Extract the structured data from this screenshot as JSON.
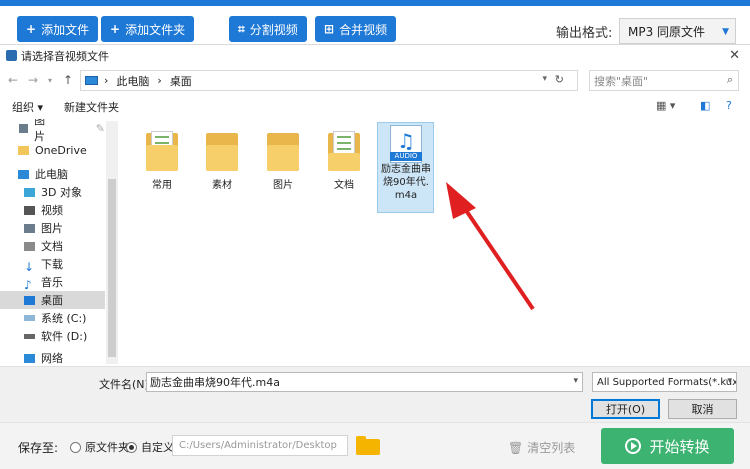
{
  "toolbar": {
    "add_file": "添加文件",
    "add_folder": "添加文件夹",
    "split_video": "分割视频",
    "merge_video": "合并视频",
    "format_label": "输出格式:",
    "format_value": "MP3  同原文件"
  },
  "dialog": {
    "title": "请选择音视频文件",
    "breadcrumb": [
      "此电脑",
      "桌面"
    ],
    "search_placeholder": "搜索\"桌面\"",
    "organize": "组织 ▾",
    "new_folder": "新建文件夹",
    "nav_items": [
      {
        "label": "图片",
        "icon": "picture-icon"
      },
      {
        "label": "OneDrive",
        "icon": "folder-icon"
      },
      {
        "label": "此电脑",
        "icon": "pc-icon"
      },
      {
        "label": "3D 对象",
        "icon": "cube-icon"
      },
      {
        "label": "视频",
        "icon": "video-icon"
      },
      {
        "label": "图片",
        "icon": "picture-icon"
      },
      {
        "label": "文档",
        "icon": "document-icon"
      },
      {
        "label": "下载",
        "icon": "download-icon"
      },
      {
        "label": "音乐",
        "icon": "music-icon"
      },
      {
        "label": "桌面",
        "icon": "desktop-icon"
      },
      {
        "label": "系统 (C:)",
        "icon": "drive-icon"
      },
      {
        "label": "软件 (D:)",
        "icon": "drive-icon"
      },
      {
        "label": "网络",
        "icon": "network-icon"
      }
    ],
    "files": [
      {
        "name": "常用"
      },
      {
        "name": "素材"
      },
      {
        "name": "图片"
      },
      {
        "name": "文档"
      }
    ],
    "selected_file": {
      "line1": "励志金曲串",
      "line2": "烧90年代.",
      "line3": "m4a",
      "tag": "AUDIO"
    },
    "filename_label": "文件名(N):",
    "filename_value": "励志金曲串烧90年代.m4a",
    "filter_value": "All Supported Formats(*.kux",
    "open_button": "打开(O)",
    "cancel_button": "取消"
  },
  "footer": {
    "save_label": "保存至:",
    "radio_original": "原文件夹",
    "radio_custom": "自定义",
    "path_value": "C:/Users/Administrator/Desktop",
    "clear_list": "清空列表",
    "start_button": "开始转换"
  },
  "colors": {
    "accent": "#1e78d6",
    "start": "#3cb371",
    "arrow": "#e02020"
  }
}
